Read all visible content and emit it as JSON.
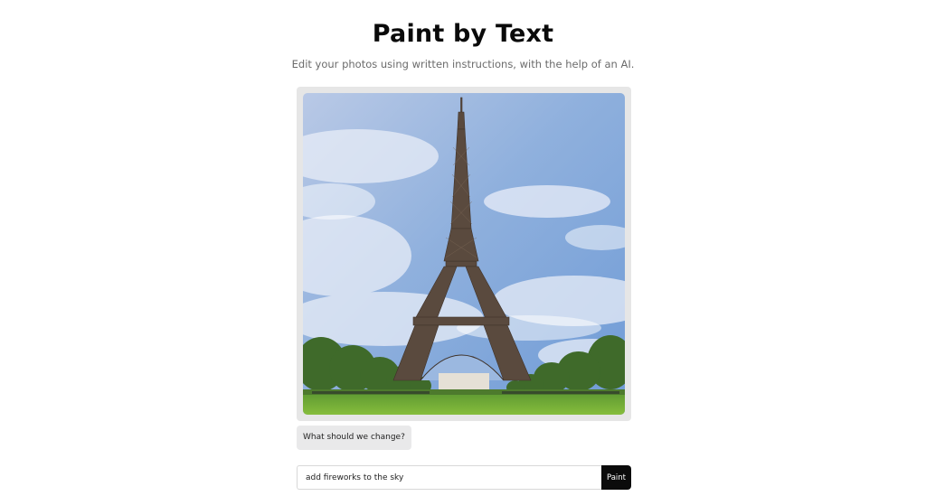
{
  "header": {
    "title": "Paint by Text",
    "subtitle": "Edit your photos using written instructions, with the help of an AI."
  },
  "image": {
    "subject": "Eiffel Tower under a blue sky with wispy clouds and green park trees"
  },
  "chat": {
    "prompt": "What should we change?"
  },
  "form": {
    "input_value": "add fireworks to the sky",
    "submit_label": "Paint"
  }
}
